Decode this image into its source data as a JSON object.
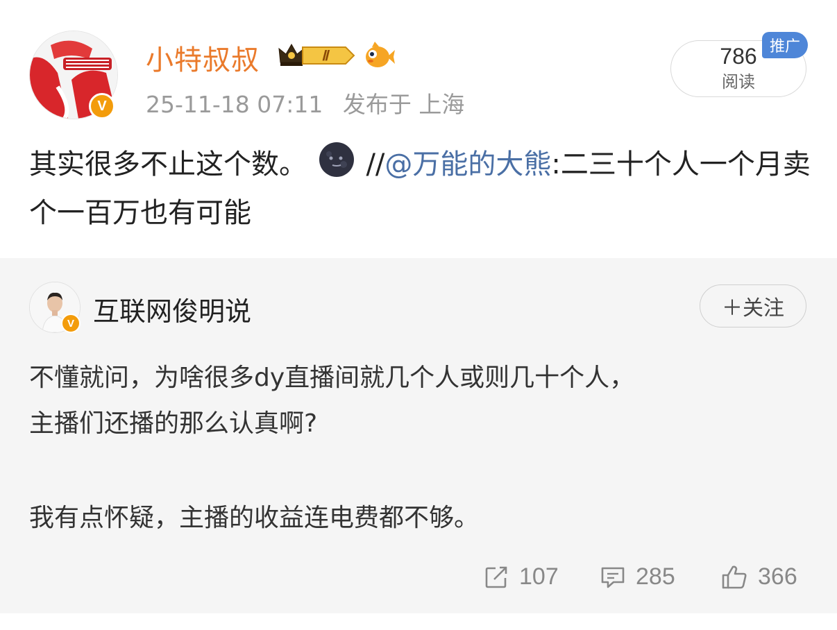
{
  "post": {
    "author": "小特叔叔",
    "badge_level": "Ⅱ",
    "timestamp": "25-11-18 07:11",
    "location": "发布于 上海",
    "reads_count": "786",
    "reads_label": "阅读",
    "promo_tag": "推广",
    "text_part1": "其实很多不止这个数。",
    "text_sep": "//",
    "mention": "@万能的大熊",
    "text_part2": ":二三十个人一个月卖个一百万也有可能"
  },
  "repost": {
    "author": "互联网俊明说",
    "follow_label": "＋关注",
    "line1": "不懂就问，为啥很多dy直播间就几个人或则几十个人，",
    "line2": "主播们还播的那么认真啊?",
    "line3": "我有点怀疑，主播的收益连电费都不够。"
  },
  "actions": {
    "repost_count": "107",
    "comment_count": "285",
    "like_count": "366"
  },
  "icons": {
    "verified": "verified-v-icon",
    "crown": "crown-badge-icon",
    "fish": "fish-emoji-icon",
    "moon": "moon-emoji-icon",
    "repost": "repost-icon",
    "comment": "comment-icon",
    "like": "like-icon"
  },
  "colors": {
    "author_orange": "#ea7a2b",
    "mention_blue": "#4a6fa5",
    "promo_blue": "#4e86d8",
    "verified_orange": "#f39c0b",
    "repost_bg": "#f5f5f5"
  }
}
